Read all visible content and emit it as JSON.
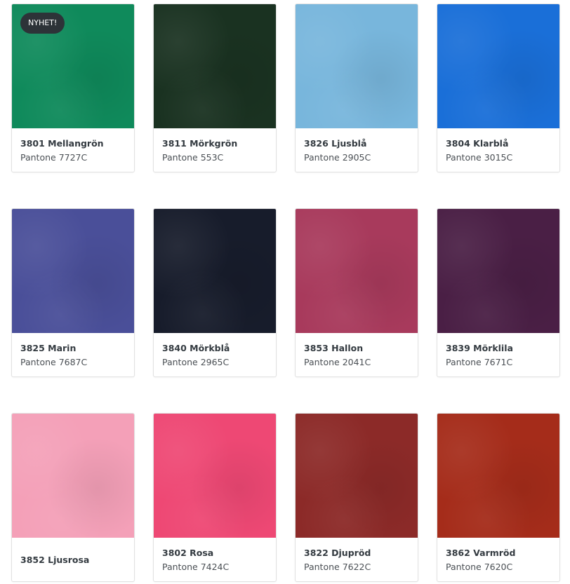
{
  "products": [
    {
      "name": "3801 Mellangrön",
      "pantone": "Pantone 7727C",
      "color": "#0f8a5b",
      "badge": "NYHET!"
    },
    {
      "name": "3811 Mörkgrön",
      "pantone": "Pantone 553C",
      "color": "#1a3221"
    },
    {
      "name": "3826 Ljusblå",
      "pantone": "Pantone 2905C",
      "color": "#78b6dc"
    },
    {
      "name": "3804 Klarblå",
      "pantone": "Pantone 3015C",
      "color": "#1a6fd8"
    },
    {
      "name": "3825 Marin",
      "pantone": "Pantone 7687C",
      "color": "#4a4f99"
    },
    {
      "name": "3840 Mörkblå",
      "pantone": "Pantone 2965C",
      "color": "#171c2b"
    },
    {
      "name": "3853 Hallon",
      "pantone": "Pantone 2041C",
      "color": "#a83a5c"
    },
    {
      "name": "3839 Mörklila",
      "pantone": "Pantone 7671C",
      "color": "#4a1f45"
    },
    {
      "name": "3852 Ljusrosa",
      "pantone": "",
      "color": "#f4a0b8"
    },
    {
      "name": "3802 Rosa",
      "pantone": "Pantone 7424C",
      "color": "#ee4874"
    },
    {
      "name": "3822 Djupröd",
      "pantone": "Pantone 7622C",
      "color": "#8c2a28"
    },
    {
      "name": "3862 Varmröd",
      "pantone": "Pantone 7620C",
      "color": "#a52c1a"
    }
  ]
}
